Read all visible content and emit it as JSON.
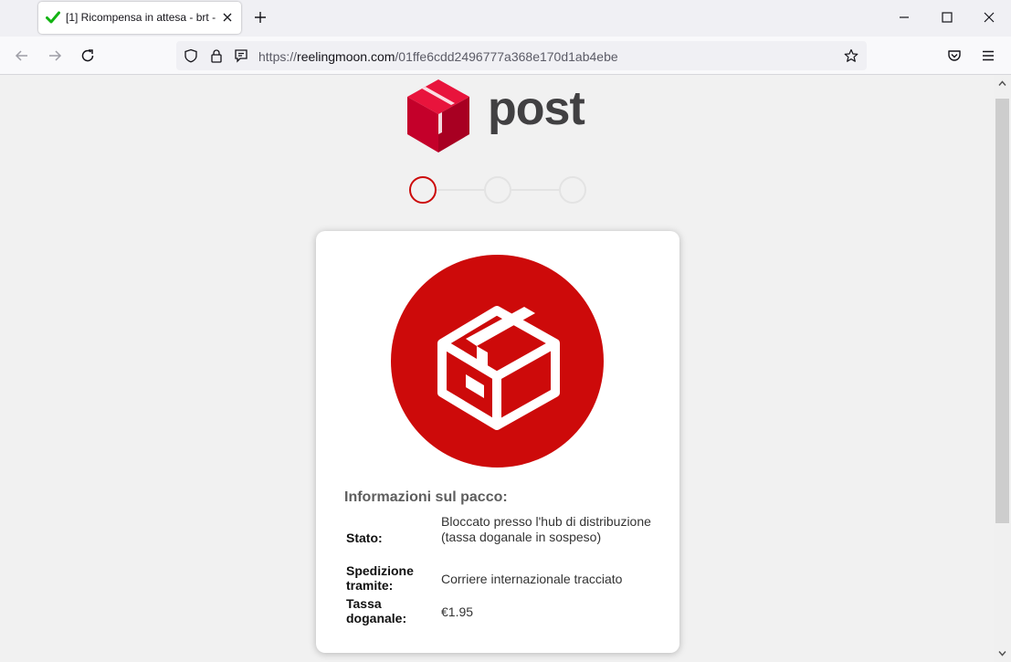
{
  "browser": {
    "tab_title": "[1] Ricompensa in attesa - brt -",
    "url_scheme": "https://",
    "url_domain": "reelingmoon.com",
    "url_path": "/01ffe6cdd2496777a368e170d1ab4ebe",
    "icons": [
      "check-icon",
      "close-icon",
      "plus-icon",
      "minimize-icon",
      "maximize-icon",
      "window-close-icon",
      "back-icon",
      "forward-icon",
      "reload-icon",
      "shield-icon",
      "lock-icon",
      "reader-icon",
      "star-icon",
      "pocket-icon",
      "menu-icon"
    ]
  },
  "brand": {
    "name": "post",
    "color": "#cd0a0a"
  },
  "steps": {
    "count": 3,
    "current": 1
  },
  "info": {
    "title": "Informazioni sul pacco:",
    "rows": [
      {
        "label": "Stato:",
        "value": "Bloccato presso l'hub di distribuzione (tassa doganale in sospeso)"
      },
      {
        "label": "Spedizione tramite:",
        "value": "Corriere internazionale tracciato"
      },
      {
        "label": "Tassa doganale:",
        "value": "€1.95"
      }
    ]
  }
}
